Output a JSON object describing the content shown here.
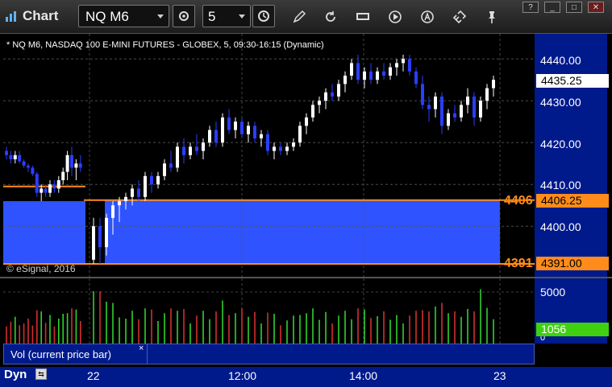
{
  "window": {
    "title": "Chart",
    "controls": [
      "?",
      "_",
      "□",
      "✕"
    ]
  },
  "toolbar": {
    "symbol": "NQ M6",
    "interval": "5"
  },
  "chart": {
    "header": "* NQ M6, NASDAQ 100 E-MINI FUTURES - GLOBEX, 5, 09:30-16:15 (Dynamic)",
    "copyright": "© eSignal, 2016",
    "price_axis_labels": [
      "4440.00",
      "4430.00",
      "4420.00",
      "4410.00",
      "4400.00"
    ],
    "last_price": "4435.25",
    "upper_level_tag": "4406",
    "upper_level_price": "4406.25",
    "lower_level_tag": "4391",
    "lower_level_price": "4391.00",
    "colors": {
      "up_candle": "#ffffff",
      "down_candle": "#2b3dff",
      "zone_fill": "#2e53ff",
      "level_line": "#ff8c1a",
      "axis_bg": "#001a8c"
    }
  },
  "volume": {
    "axis_label": "5000",
    "axis_zero": "0",
    "last_volume": "1056",
    "legend": "Vol (current price bar)",
    "close_glyph": "×"
  },
  "time_axis": {
    "mode": "Dyn",
    "labels": [
      "22",
      "12:00",
      "14:00",
      "23"
    ]
  },
  "chart_data": {
    "type": "candlestick",
    "symbol": "NQ M6",
    "interval_minutes": 5,
    "ylim": [
      4389,
      4446
    ],
    "levels": [
      4406.25,
      4391.0
    ],
    "last": 4435.25,
    "candles_prev_day": [
      [
        4418,
        4419,
        4416,
        4417
      ],
      [
        4417,
        4418,
        4415,
        4416
      ],
      [
        4416,
        4418,
        4415,
        4417
      ],
      [
        4417,
        4418,
        4415,
        4415.5
      ],
      [
        4415.5,
        4416,
        4414,
        4414.5
      ],
      [
        4414.5,
        4415,
        4413,
        4414
      ],
      [
        4414,
        4414.5,
        4412,
        4412.5
      ],
      [
        4412.5,
        4413,
        4407,
        4408
      ],
      [
        4408,
        4410,
        4406,
        4409
      ],
      [
        4409,
        4410,
        4407,
        4408
      ],
      [
        4408,
        4411,
        4407,
        4410
      ],
      [
        4410,
        4411,
        4408,
        4409
      ],
      [
        4409,
        4412,
        4408,
        4411
      ],
      [
        4411,
        4414,
        4410,
        4413
      ],
      [
        4413,
        4418,
        4411,
        4417
      ],
      [
        4417,
        4419,
        4412,
        4414
      ],
      [
        4414,
        4416,
        4411,
        4415
      ],
      [
        4415,
        4417,
        4413,
        4414
      ]
    ],
    "candles": [
      [
        4392,
        4402,
        4391,
        4400
      ],
      [
        4400,
        4402,
        4391,
        4395
      ],
      [
        4395,
        4403,
        4393,
        4402
      ],
      [
        4402,
        4406,
        4398,
        4405
      ],
      [
        4405,
        4407,
        4401,
        4406
      ],
      [
        4406,
        4408,
        4404,
        4407
      ],
      [
        4407,
        4410,
        4405,
        4409
      ],
      [
        4409,
        4411,
        4406,
        4407
      ],
      [
        4407,
        4413,
        4406,
        4412
      ],
      [
        4412,
        4413,
        4408,
        4410
      ],
      [
        4410,
        4413,
        4409,
        4412
      ],
      [
        4412,
        4416,
        4411,
        4415
      ],
      [
        4415,
        4418,
        4413,
        4414
      ],
      [
        4414,
        4420,
        4413,
        4419
      ],
      [
        4419,
        4421,
        4415,
        4417
      ],
      [
        4417,
        4420,
        4416,
        4419
      ],
      [
        4419,
        4422,
        4417,
        4418
      ],
      [
        4418,
        4421,
        4416,
        4420
      ],
      [
        4420,
        4424,
        4419,
        4423
      ],
      [
        4423,
        4425,
        4419,
        4420
      ],
      [
        4420,
        4427,
        4419,
        4426
      ],
      [
        4426,
        4428,
        4422,
        4423
      ],
      [
        4423,
        4426,
        4421,
        4425
      ],
      [
        4425,
        4426,
        4421,
        4422
      ],
      [
        4422,
        4425,
        4420,
        4424
      ],
      [
        4424,
        4425,
        4420,
        4421
      ],
      [
        4421,
        4423,
        4419,
        4422
      ],
      [
        4422,
        4423,
        4417,
        4418
      ],
      [
        4418,
        4420,
        4416,
        4419
      ],
      [
        4419,
        4420,
        4417,
        4418
      ],
      [
        4418,
        4420,
        4417,
        4419
      ],
      [
        4419,
        4421,
        4418,
        4420
      ],
      [
        4420,
        4425,
        4419,
        4424
      ],
      [
        4424,
        4427,
        4422,
        4426
      ],
      [
        4426,
        4430,
        4425,
        4429
      ],
      [
        4429,
        4431,
        4427,
        4430
      ],
      [
        4430,
        4433,
        4428,
        4432
      ],
      [
        4432,
        4434,
        4430,
        4431
      ],
      [
        4431,
        4435,
        4430,
        4434
      ],
      [
        4434,
        4437,
        4432,
        4436
      ],
      [
        4436,
        4440,
        4435,
        4439
      ],
      [
        4439,
        4441,
        4434,
        4435
      ],
      [
        4435,
        4438,
        4433,
        4437
      ],
      [
        4437,
        4439,
        4434,
        4435
      ],
      [
        4435,
        4438,
        4434,
        4437
      ],
      [
        4437,
        4439,
        4435,
        4436
      ],
      [
        4436,
        4439,
        4435,
        4438
      ],
      [
        4438,
        4440,
        4436,
        4439
      ],
      [
        4439,
        4441,
        4437,
        4440
      ],
      [
        4440,
        4441,
        4436,
        4437
      ],
      [
        4437,
        4438,
        4433,
        4434
      ],
      [
        4434,
        4436,
        4428,
        4429
      ],
      [
        4429,
        4431,
        4425,
        4428
      ],
      [
        4428,
        4432,
        4426,
        4431
      ],
      [
        4431,
        4432,
        4422,
        4424
      ],
      [
        4424,
        4428,
        4423,
        4427
      ],
      [
        4427,
        4429,
        4425,
        4426
      ],
      [
        4426,
        4430,
        4425,
        4429
      ],
      [
        4429,
        4433,
        4427,
        4431
      ],
      [
        4431,
        4432,
        4424,
        4426
      ],
      [
        4426,
        4431,
        4425,
        4430
      ],
      [
        4430,
        4434,
        4428,
        4433
      ],
      [
        4433,
        4436,
        4431,
        4435
      ]
    ],
    "volume_ylim": [
      0,
      6000
    ],
    "volume_last": 1056
  }
}
